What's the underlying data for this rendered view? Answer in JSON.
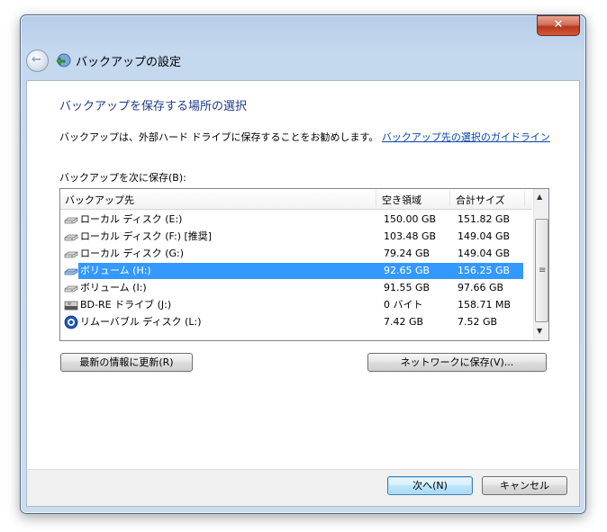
{
  "window": {
    "title": "バックアップの設定",
    "close_label": "✕"
  },
  "main": {
    "heading": "バックアップを保存する場所の選択",
    "recommend_text": "バックアップは、外部ハード ドライブに保存することをお勧めします。",
    "guide_link": "バックアップ先の選択のガイドライン",
    "save_label": "バックアップを次に保存(B):"
  },
  "list": {
    "columns": [
      "バックアップ先",
      "空き領域",
      "合計サイズ"
    ],
    "selected_index": 3,
    "rows": [
      {
        "name": "ローカル ディスク (E:)",
        "free": "150.00 GB",
        "total": "151.82 GB",
        "icon": "hard-drive-icon"
      },
      {
        "name": "ローカル ディスク (F:) [推奨]",
        "free": "103.48 GB",
        "total": "149.04 GB",
        "icon": "hard-drive-icon"
      },
      {
        "name": "ローカル ディスク (G:)",
        "free": "79.24 GB",
        "total": "149.04 GB",
        "icon": "hard-drive-icon"
      },
      {
        "name": "ボリューム (H:)",
        "free": "92.65 GB",
        "total": "156.25 GB",
        "icon": "hard-drive-icon"
      },
      {
        "name": "ボリューム (I:)",
        "free": "91.55 GB",
        "total": "97.66 GB",
        "icon": "hard-drive-icon"
      },
      {
        "name": "BD-RE ドライブ (J:)",
        "free": "0 バイト",
        "total": "158.71 MB",
        "icon": "bd-drive-icon"
      },
      {
        "name": "リムーバブル ディスク (L:)",
        "free": "7.42 GB",
        "total": "7.52 GB",
        "icon": "removable-disk-icon"
      }
    ]
  },
  "buttons": {
    "refresh": "最新の情報に更新(R)",
    "network": "ネットワークに保存(V)...",
    "next": "次へ(N)",
    "cancel": "キャンセル"
  },
  "colors": {
    "heading": "#1e3b8a",
    "link": "#0645ad",
    "selection": "#3399ff"
  }
}
